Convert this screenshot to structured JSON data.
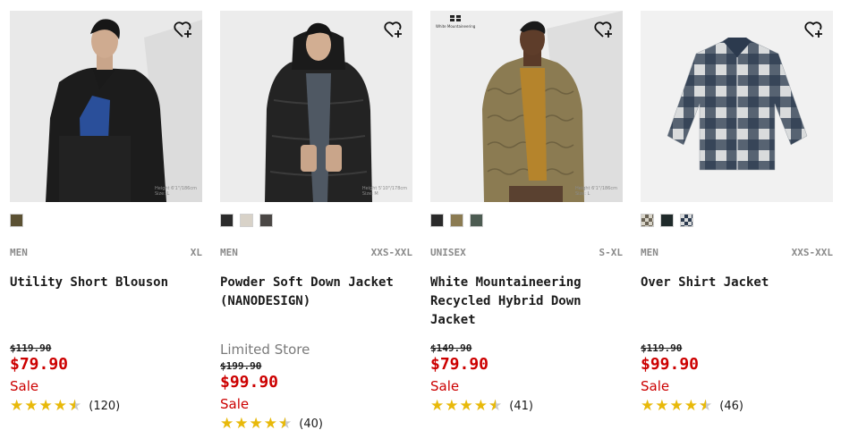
{
  "colors": {
    "sale_red": "#cc0000",
    "star_gold": "#e8b90a",
    "muted_gray": "#8a8a8a"
  },
  "wishlist_icon": "heart-plus-icon",
  "products": [
    {
      "gender": "MEN",
      "size_range": "XL",
      "name": "Utility Short Blouson",
      "photo_caption_1": "Height 6'1\"/186cm",
      "photo_caption_2": "Size: L",
      "swatches": [
        "#5b5133"
      ],
      "original_price": "$119.90",
      "price": "$79.90",
      "sale_label": "Sale",
      "rating": 4.5,
      "review_count": "(120)"
    },
    {
      "gender": "MEN",
      "size_range": "XXS-XXL",
      "name": "Powder Soft Down Jacket (NANODESIGN)",
      "photo_caption_1": "Height 5'10\"/178cm",
      "photo_caption_2": "Size: M",
      "swatches": [
        "#2b2b2b",
        "#d8d2c8",
        "#4a4745"
      ],
      "limited_label": "Limited Store",
      "original_price": "$199.90",
      "price": "$99.90",
      "sale_label": "Sale",
      "rating": 4.5,
      "review_count": "(40)"
    },
    {
      "gender": "UNISEX",
      "size_range": "S-XL",
      "name": "White Mountaineering Recycled Hybrid Down Jacket",
      "photo_tag": "White Mountaineering",
      "photo_caption_1": "Height 6'1\"/186cm",
      "photo_caption_2": "Size: L",
      "swatches": [
        "#2a2a2a",
        "#8b7b52",
        "#4d5c52"
      ],
      "original_price": "$149.90",
      "price": "$79.90",
      "sale_label": "Sale",
      "rating": 4.5,
      "review_count": "(41)"
    },
    {
      "gender": "MEN",
      "size_range": "XXS-XXL",
      "name": "Over Shirt Jacket",
      "swatches": [
        "check-beige",
        "#1f2a2a",
        "check-navy"
      ],
      "original_price": "$119.90",
      "price": "$99.90",
      "sale_label": "Sale",
      "rating": 4.5,
      "review_count": "(46)"
    }
  ]
}
